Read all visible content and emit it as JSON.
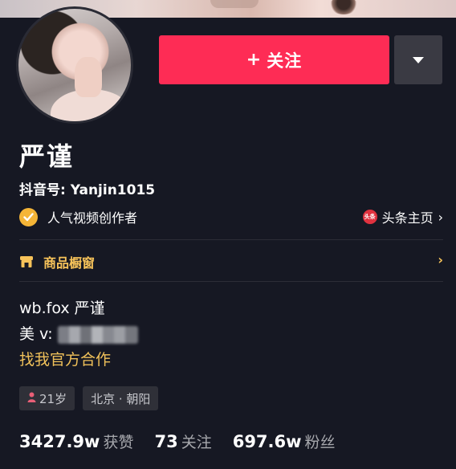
{
  "profile": {
    "name": "严谨",
    "account_id": "抖音号: Yanjin1015",
    "certification": "人气视频创作者",
    "toutiao_label": "头条主页",
    "toutiao_icon_text": "头条"
  },
  "actions": {
    "follow_label": "关注",
    "follow_plus": "+"
  },
  "shop": {
    "label": "商品橱窗"
  },
  "bio": {
    "line1": "wb.fox 严谨",
    "line2": "美 v:",
    "line3": "找我官方合作"
  },
  "tags": {
    "age": "21岁",
    "location": "北京 · 朝阳"
  },
  "stats": {
    "likes_num": "3427.9w",
    "likes_label": "获赞",
    "following_num": "73",
    "following_label": "关注",
    "fans_num": "697.6w",
    "fans_label": "粉丝"
  },
  "colors": {
    "background": "#161823",
    "follow_button": "#fe2c55",
    "gold_accent": "#f7c35a",
    "cert_badge": "#f5b537"
  }
}
